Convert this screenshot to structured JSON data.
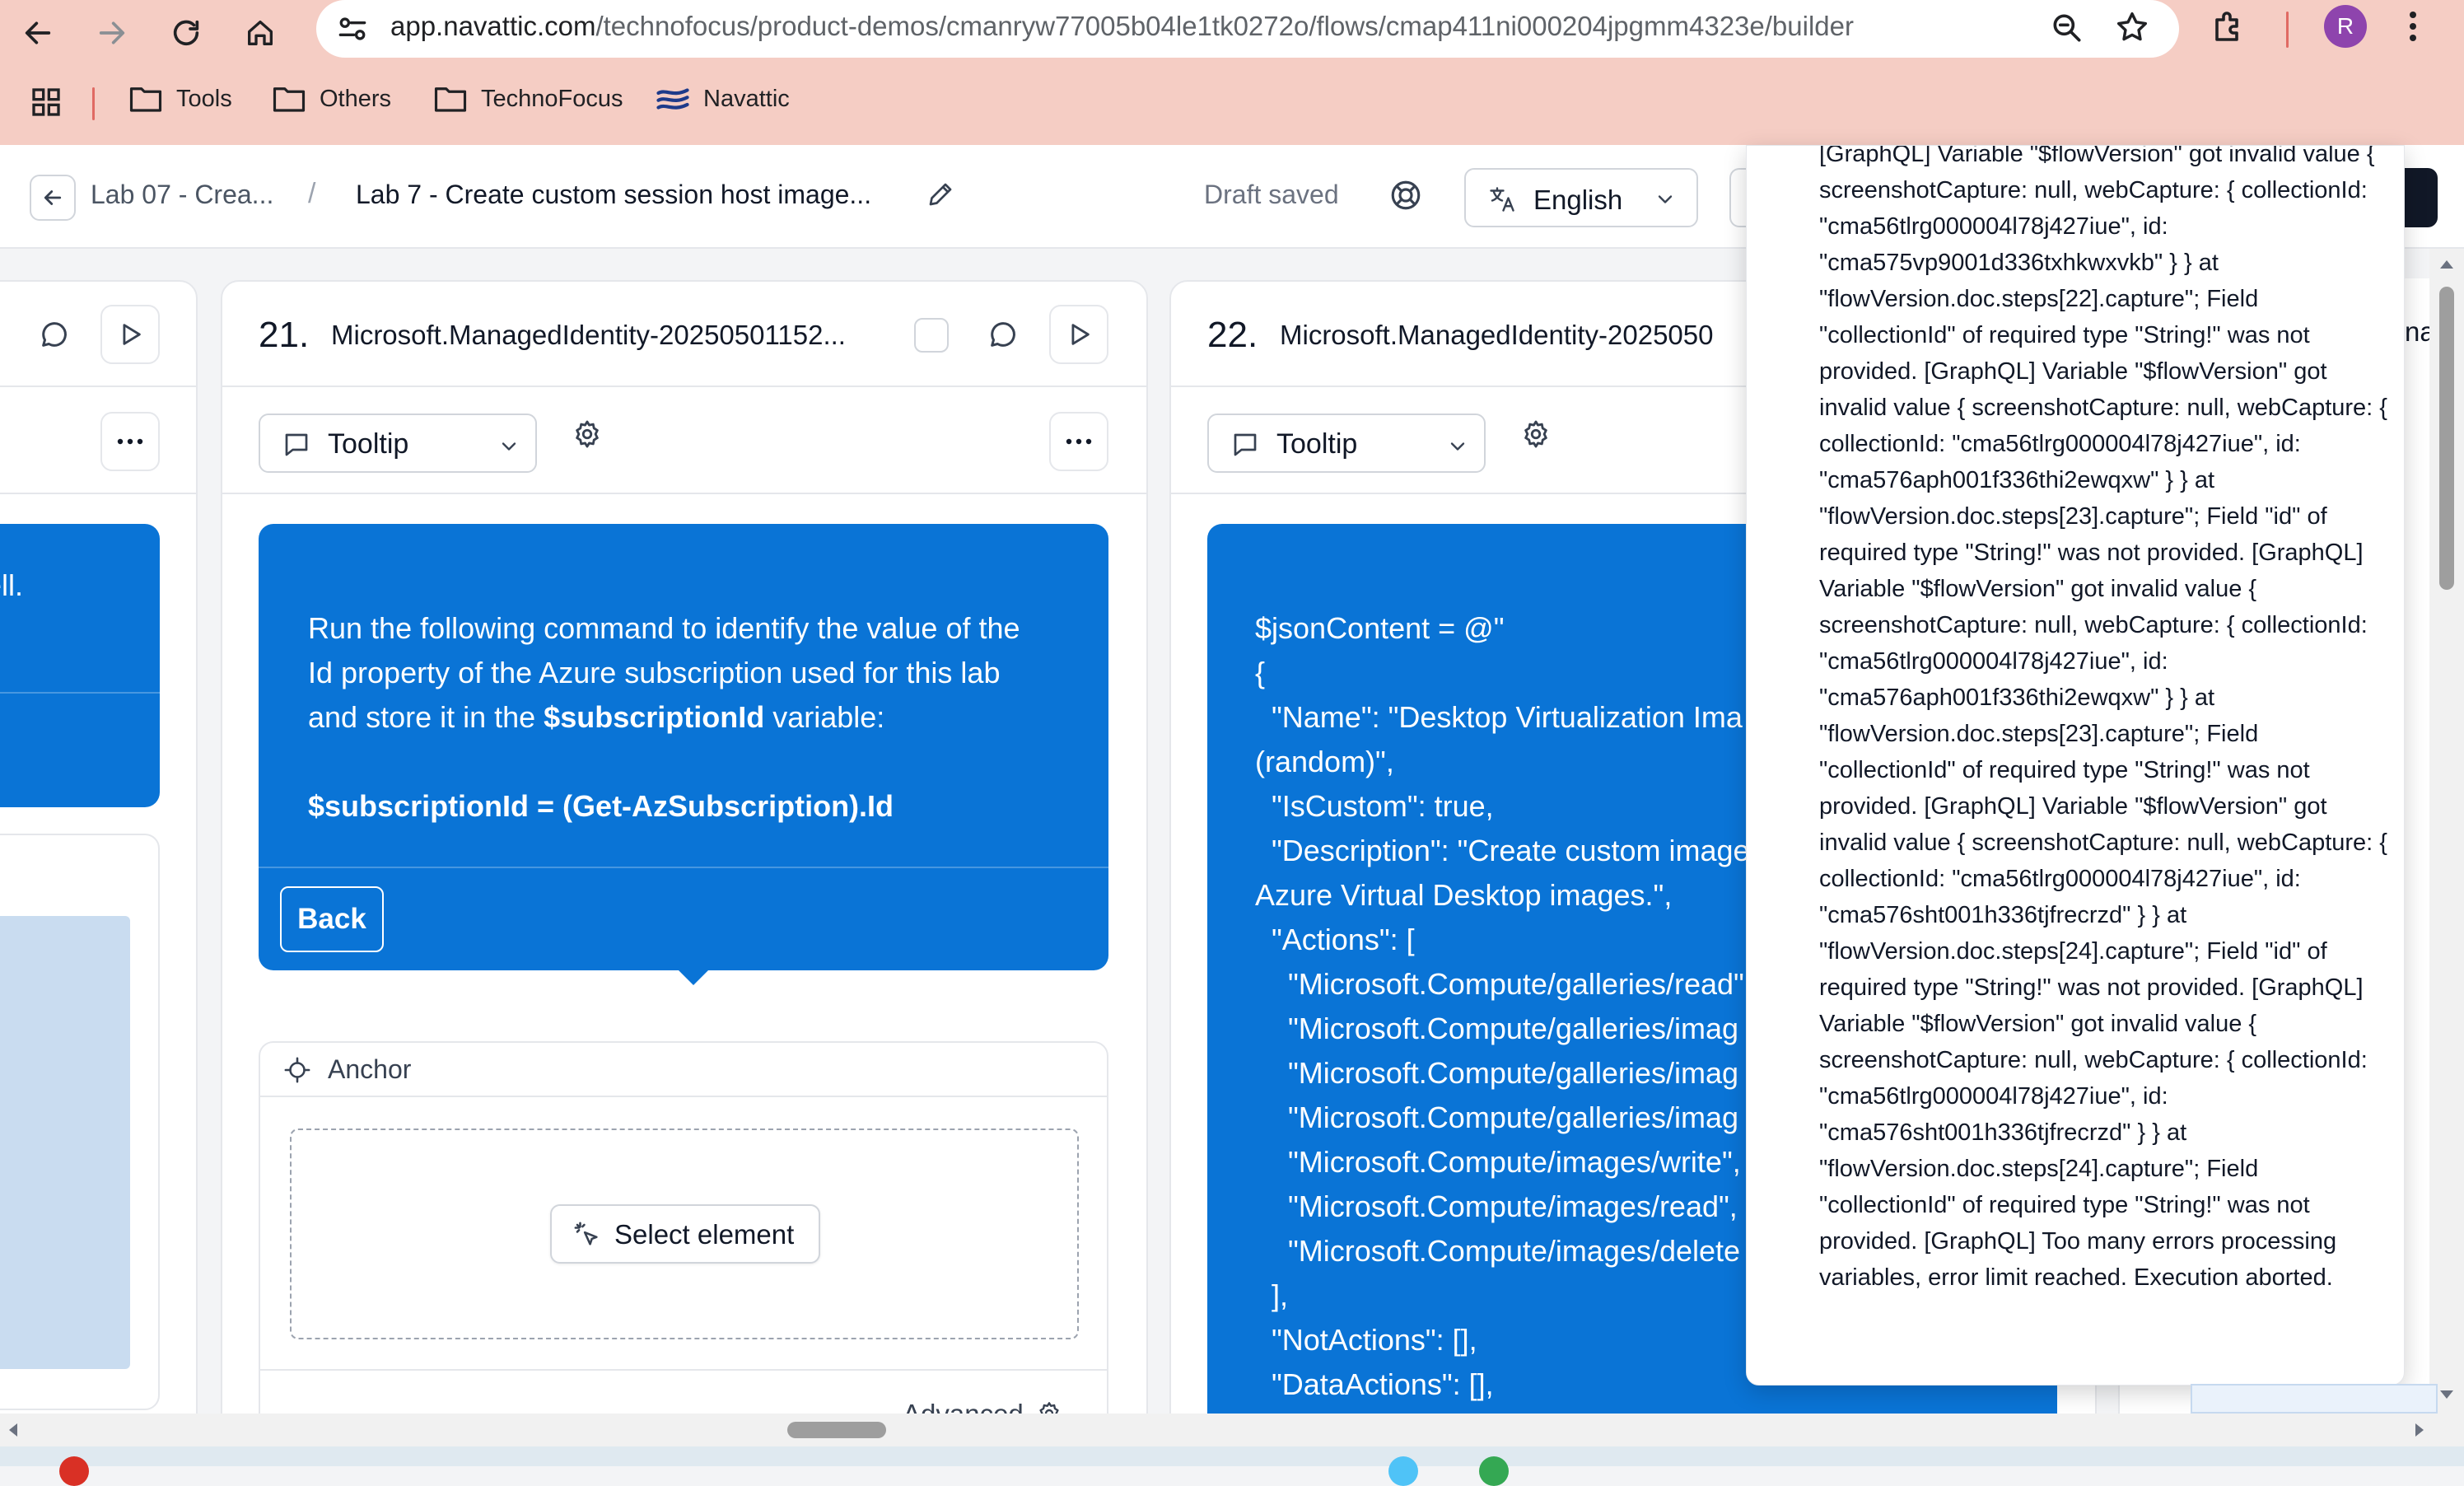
{
  "browser": {
    "url_domain": "app.navattic.com",
    "url_path": "/technofocus/product-demos/cmanryw77005b04le1tk0272o/flows/cmap411ni000204jpgmm4323e/builder",
    "profile_initial": "R",
    "bookmarks": [
      "Tools",
      "Others",
      "TechnoFocus",
      "Navattic"
    ]
  },
  "header": {
    "breadcrumb_parent": "Lab 07 - Crea...",
    "breadcrumb_sep": "/",
    "flow_title": "Lab 7 - Create custom session host image...",
    "status": "Draft saved",
    "language": "English"
  },
  "steps": [
    {
      "number": "21.",
      "title": "Microsoft.ManagedIdentity-20250501152...",
      "type": "Tooltip",
      "tooltip_line1": "Run the following command to identify the value of the",
      "tooltip_line2": "Id property of the Azure subscription used for this lab",
      "tooltip_line3a": "and store it in the ",
      "tooltip_line3b": "$subscriptionId",
      "tooltip_line3c": " variable:",
      "tooltip_command": "$subscriptionId = (Get-AzSubscription).Id",
      "back_label": "Back",
      "anchor_label": "Anchor",
      "select_label": "Select element",
      "advanced_label": "Advanced"
    },
    {
      "number": "22.",
      "title": "Microsoft.ManagedIdentity-2025050",
      "type": "Tooltip",
      "code": "$jsonContent = @\"\n{\n  \"Name\": \"Desktop Virtualization Ima\n(random)\",\n  \"IsCustom\": true,\n  \"Description\": \"Create custom image\nAzure Virtual Desktop images.\",\n  \"Actions\": [\n    \"Microsoft.Compute/galleries/read\"\n    \"Microsoft.Compute/galleries/imag\n    \"Microsoft.Compute/galleries/imag\n    \"Microsoft.Compute/galleries/imag\n    \"Microsoft.Compute/images/write\",\n    \"Microsoft.Compute/images/read\",\n    \"Microsoft.Compute/images/delete\n  ],\n  \"NotActions\": [],\n  \"DataActions\": [],"
    }
  ],
  "left_partial": {
    "text": "ell."
  },
  "right_partial": {
    "text": "nag"
  },
  "error": {
    "message": "[GraphQL] Variable \"$flowVersion\" got invalid value { screenshotCapture: null, webCapture: { collectionId: \"cma56tlrg000004l78j427iue\", id: \"cma575vp9001d336txhkwxvkb\" } } at \"flowVersion.doc.steps[22].capture\"; Field \"collectionId\" of required type \"String!\" was not provided. [GraphQL] Variable \"$flowVersion\" got invalid value { screenshotCapture: null, webCapture: { collectionId: \"cma56tlrg000004l78j427iue\", id: \"cma576aph001f336thi2ewqxw\" } } at \"flowVersion.doc.steps[23].capture\"; Field \"id\" of required type \"String!\" was not provided. [GraphQL] Variable \"$flowVersion\" got invalid value { screenshotCapture: null, webCapture: { collectionId: \"cma56tlrg000004l78j427iue\", id: \"cma576aph001f336thi2ewqxw\" } } at \"flowVersion.doc.steps[23].capture\"; Field \"collectionId\" of required type \"String!\" was not provided. [GraphQL] Variable \"$flowVersion\" got invalid value { screenshotCapture: null, webCapture: { collectionId: \"cma56tlrg000004l78j427iue\", id: \"cma576sht001h336tjfrecrzd\" } } at \"flowVersion.doc.steps[24].capture\"; Field \"id\" of required type \"String!\" was not provided. [GraphQL] Variable \"$flowVersion\" got invalid value { screenshotCapture: null, webCapture: { collectionId: \"cma56tlrg000004l78j427iue\", id: \"cma576sht001h336tjfrecrzd\" } } at \"flowVersion.doc.steps[24].capture\"; Field \"collectionId\" of required type \"String!\" was not provided. [GraphQL] Too many errors processing variables, error limit reached. Execution aborted."
  },
  "colors": {
    "chrome": "#f5cdc4",
    "accent": "#0a74d6",
    "avatar": "#8e44ad"
  }
}
